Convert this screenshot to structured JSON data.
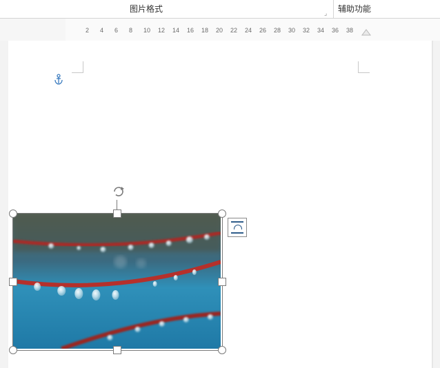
{
  "ribbon": {
    "tab_picture_format": "图片格式",
    "tab_accessibility": "辅助功能"
  },
  "ruler": {
    "ticks": [
      "2",
      "4",
      "6",
      "8",
      "10",
      "12",
      "14",
      "16",
      "18",
      "20",
      "22",
      "24",
      "26",
      "28",
      "30",
      "32",
      "34",
      "36",
      "38"
    ]
  },
  "icons": {
    "anchor": "anchor-icon",
    "rotator": "rotate-handle-icon",
    "layout_options": "layout-options-icon"
  },
  "image": {
    "alt": "水滴红线蓝色背景照片",
    "selected": true
  }
}
